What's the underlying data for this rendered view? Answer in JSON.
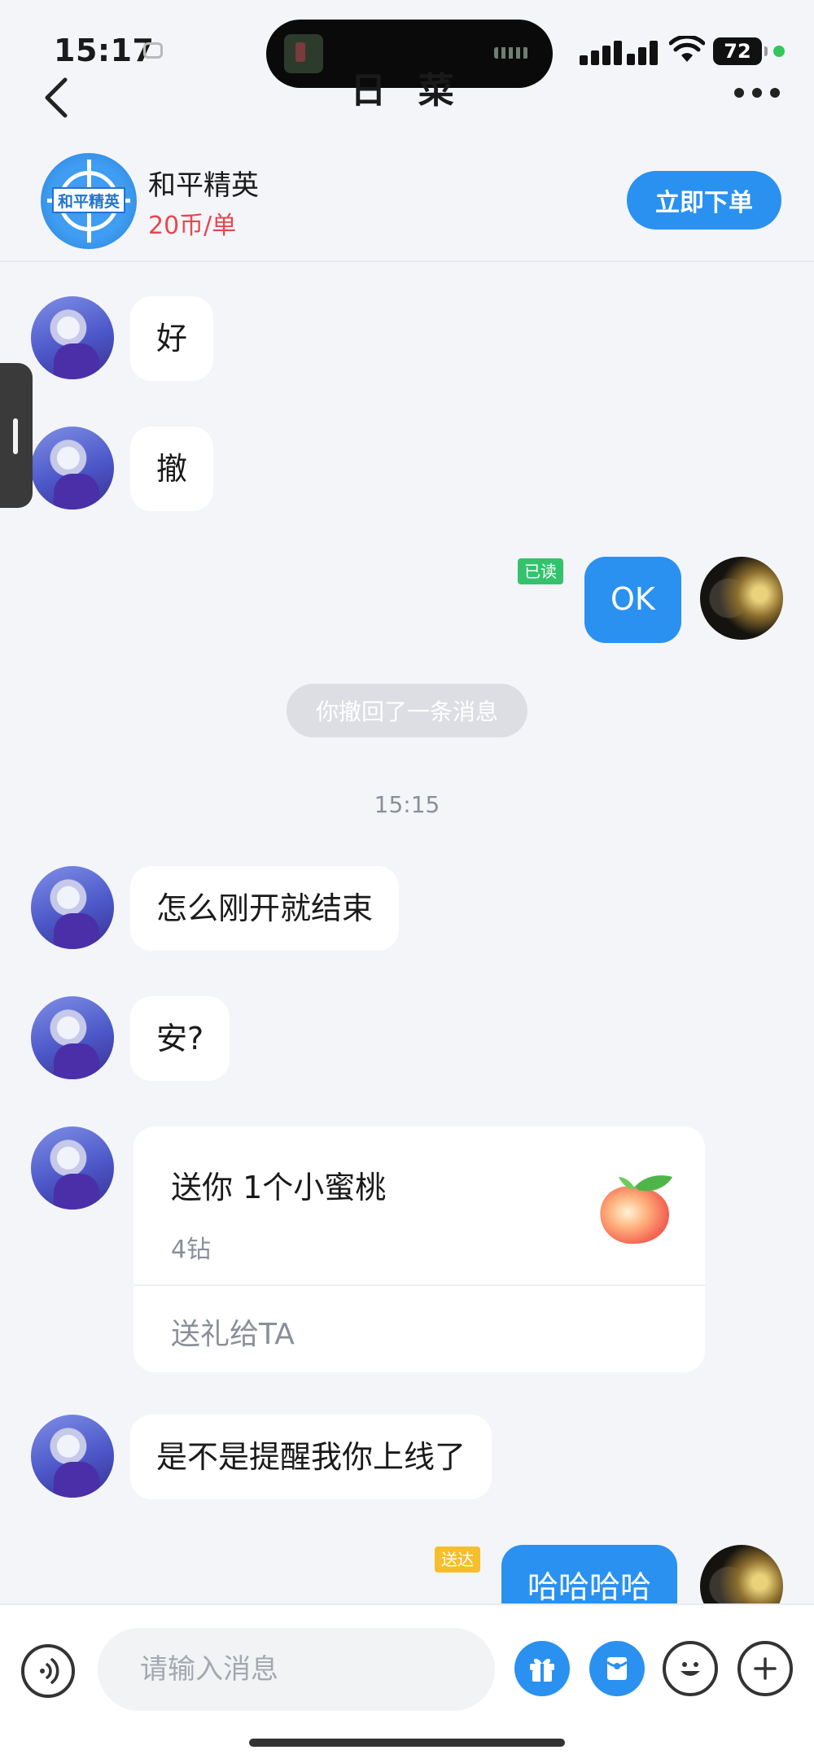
{
  "status_bar": {
    "time": "15:17",
    "battery": "72"
  },
  "header": {
    "title": "日 菜"
  },
  "game_card": {
    "name": "和平精英",
    "price": "20币/单",
    "logo_text": "和平精英",
    "order_label": "立即下单"
  },
  "messages": [
    {
      "side": "left",
      "text": "好"
    },
    {
      "side": "left",
      "text": "撤"
    },
    {
      "side": "right",
      "text": "OK",
      "status": "已读"
    },
    {
      "type": "system",
      "text": "你撤回了一条消息"
    },
    {
      "type": "timestamp",
      "text": "15:15"
    },
    {
      "side": "left",
      "text": "怎么刚开就结束"
    },
    {
      "side": "left",
      "text": "安?"
    },
    {
      "type": "gift",
      "title": "送你 1个小蜜桃",
      "price": "4钻",
      "action": "送礼给TA"
    },
    {
      "side": "left",
      "text": "是不是提醒我你上线了"
    },
    {
      "side": "right",
      "text": "哈哈哈哈",
      "status": "送达"
    }
  ],
  "input_bar": {
    "placeholder": "请输入消息"
  },
  "icons": {
    "back": "chevron-left-icon",
    "more": "more-horizontal-icon",
    "voice": "voice-icon",
    "gift": "gift-icon",
    "redpack": "red-packet-icon",
    "emoji": "emoji-icon",
    "plus": "plus-icon",
    "peach": "peach-icon"
  },
  "colors": {
    "accent": "#2a91f0",
    "price": "#e5484d",
    "read_tag": "#35c26d",
    "sent_tag": "#f6be2a",
    "background": "#f3f5f9"
  }
}
